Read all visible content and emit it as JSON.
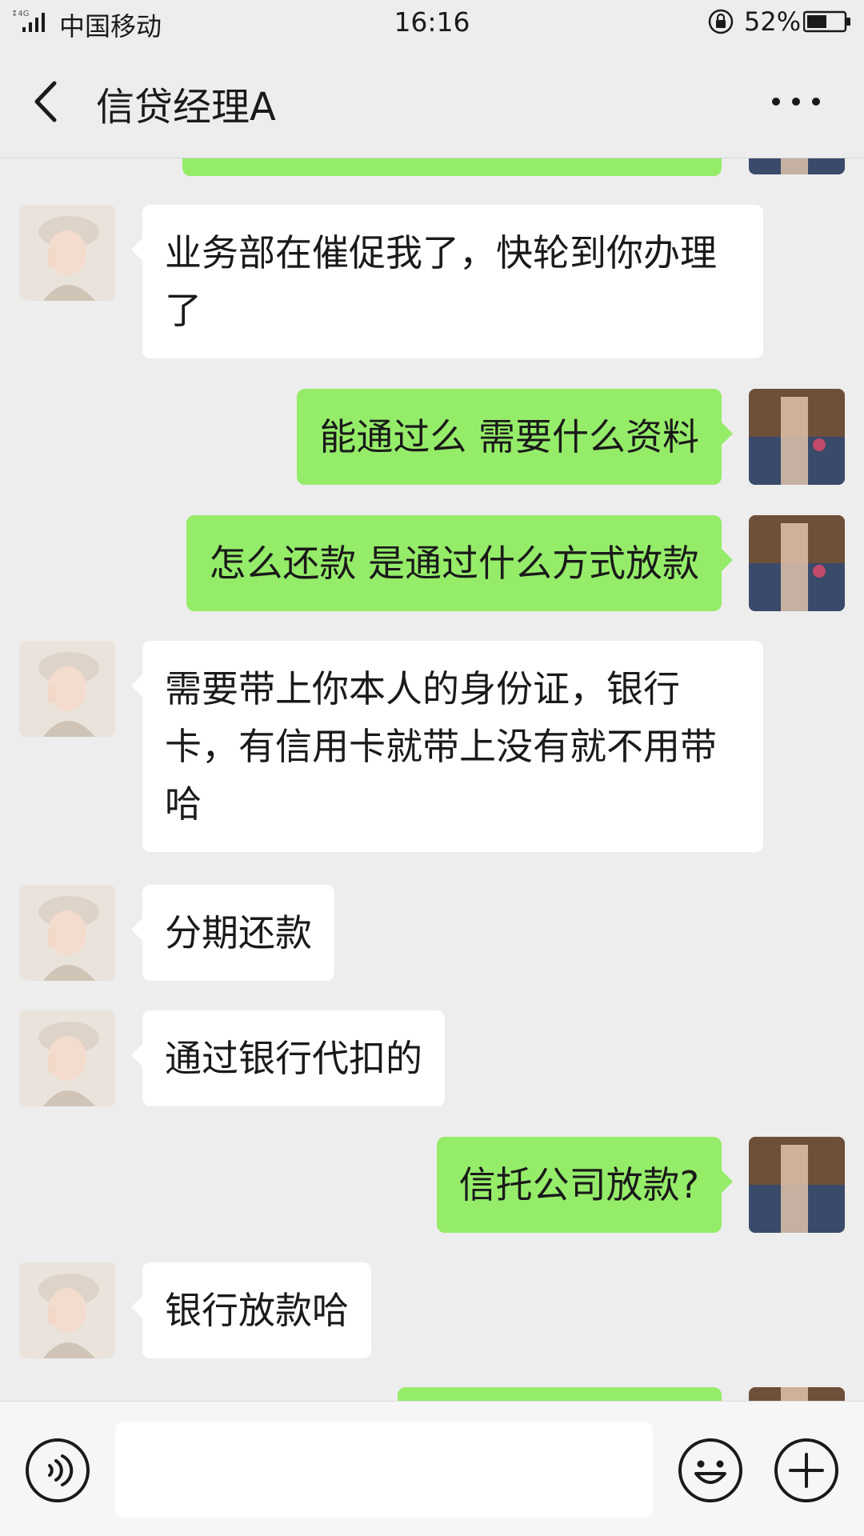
{
  "status_bar": {
    "carrier": "中国移动",
    "network": "4G",
    "time": "16:16",
    "battery": "52%"
  },
  "header": {
    "title": "信贷经理A",
    "back_icon": "chevron-left-icon",
    "more_icon": "more-dots-icon"
  },
  "messages": [
    {
      "from": "them",
      "text": "业务部在催促我了，快轮到你办理了"
    },
    {
      "from": "me",
      "text": "能通过么 需要什么资料"
    },
    {
      "from": "me",
      "text": "怎么还款 是通过什么方式放款"
    },
    {
      "from": "them",
      "text": "需要带上你本人的身份证，银行卡，有信用卡就带上没有就不用带哈"
    },
    {
      "from": "them",
      "text": "分期还款"
    },
    {
      "from": "them",
      "text": "通过银行代扣的"
    },
    {
      "from": "me",
      "text": "信托公司放款?"
    },
    {
      "from": "them",
      "text": "银行放款哈"
    }
  ],
  "input_bar": {
    "text": "",
    "voice_icon": "voice-icon",
    "emoji_icon": "emoji-icon",
    "plus_icon": "plus-icon"
  },
  "colors": {
    "background": "#ededed",
    "outgoing_bubble": "#95ec69",
    "incoming_bubble": "#ffffff"
  }
}
